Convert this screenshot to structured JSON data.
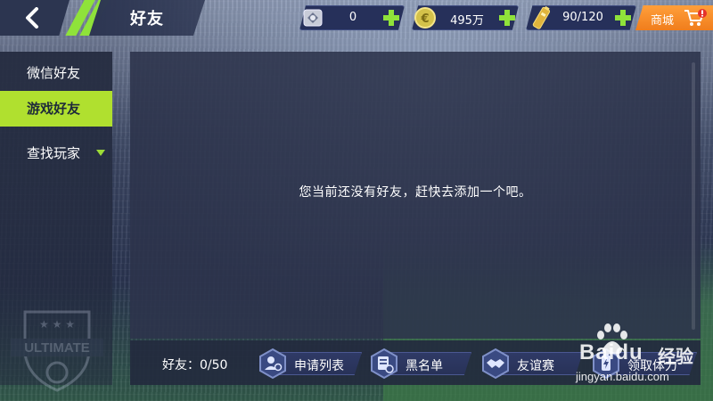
{
  "header": {
    "title": "好友",
    "back_icon": "back-arrow-icon",
    "accent_color": "#8fe23a"
  },
  "resources": [
    {
      "name": "ticket",
      "icon": "ticket-icon",
      "value": "0"
    },
    {
      "name": "coins",
      "icon": "coin-icon",
      "value": "495万"
    },
    {
      "name": "energy",
      "icon": "energy-battery-icon",
      "value": "90/120"
    }
  ],
  "shop": {
    "label": "商城",
    "icon": "cart-icon",
    "color": "#f07d1c"
  },
  "sidebar": {
    "items": [
      {
        "label": "微信好友",
        "active": false
      },
      {
        "label": "游戏好友",
        "active": true
      },
      {
        "label": "查找玩家",
        "active": false
      }
    ],
    "active_color": "#b0e02f",
    "emblem_text": "ULTIMATE"
  },
  "main": {
    "empty_message": "您当前还没有好友，赶快去添加一个吧。"
  },
  "footer": {
    "friend_count": "好友：0/50",
    "actions": [
      {
        "label": "申请列表",
        "icon": "request-list-icon"
      },
      {
        "label": "黑名单",
        "icon": "blacklist-icon"
      },
      {
        "label": "友谊赛",
        "icon": "handshake-icon"
      },
      {
        "label": "领取体力",
        "icon": "claim-energy-icon"
      }
    ]
  },
  "watermark": {
    "brand": "Baidu",
    "brand_cn": "经验",
    "url": "jingyan.baidu.com"
  }
}
